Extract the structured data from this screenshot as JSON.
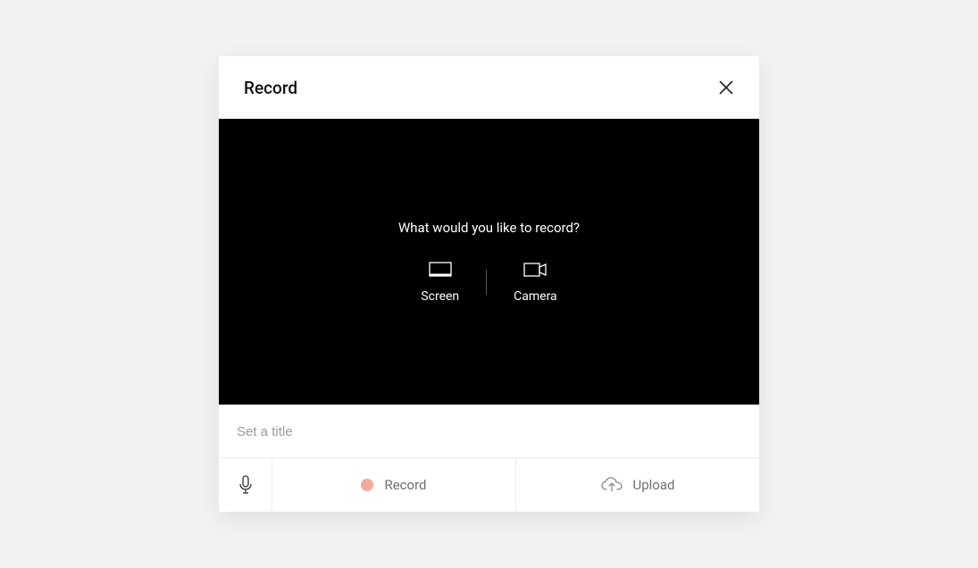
{
  "modal": {
    "title": "Record"
  },
  "preview": {
    "question": "What would you like to record?",
    "options": {
      "screen": "Screen",
      "camera": "Camera"
    }
  },
  "title_input": {
    "placeholder": "Set a title",
    "value": ""
  },
  "footer": {
    "record_label": "Record",
    "upload_label": "Upload"
  },
  "colors": {
    "record_dot": "#f3a9a0",
    "background": "#f1f2f3",
    "preview_bg": "#000000"
  }
}
